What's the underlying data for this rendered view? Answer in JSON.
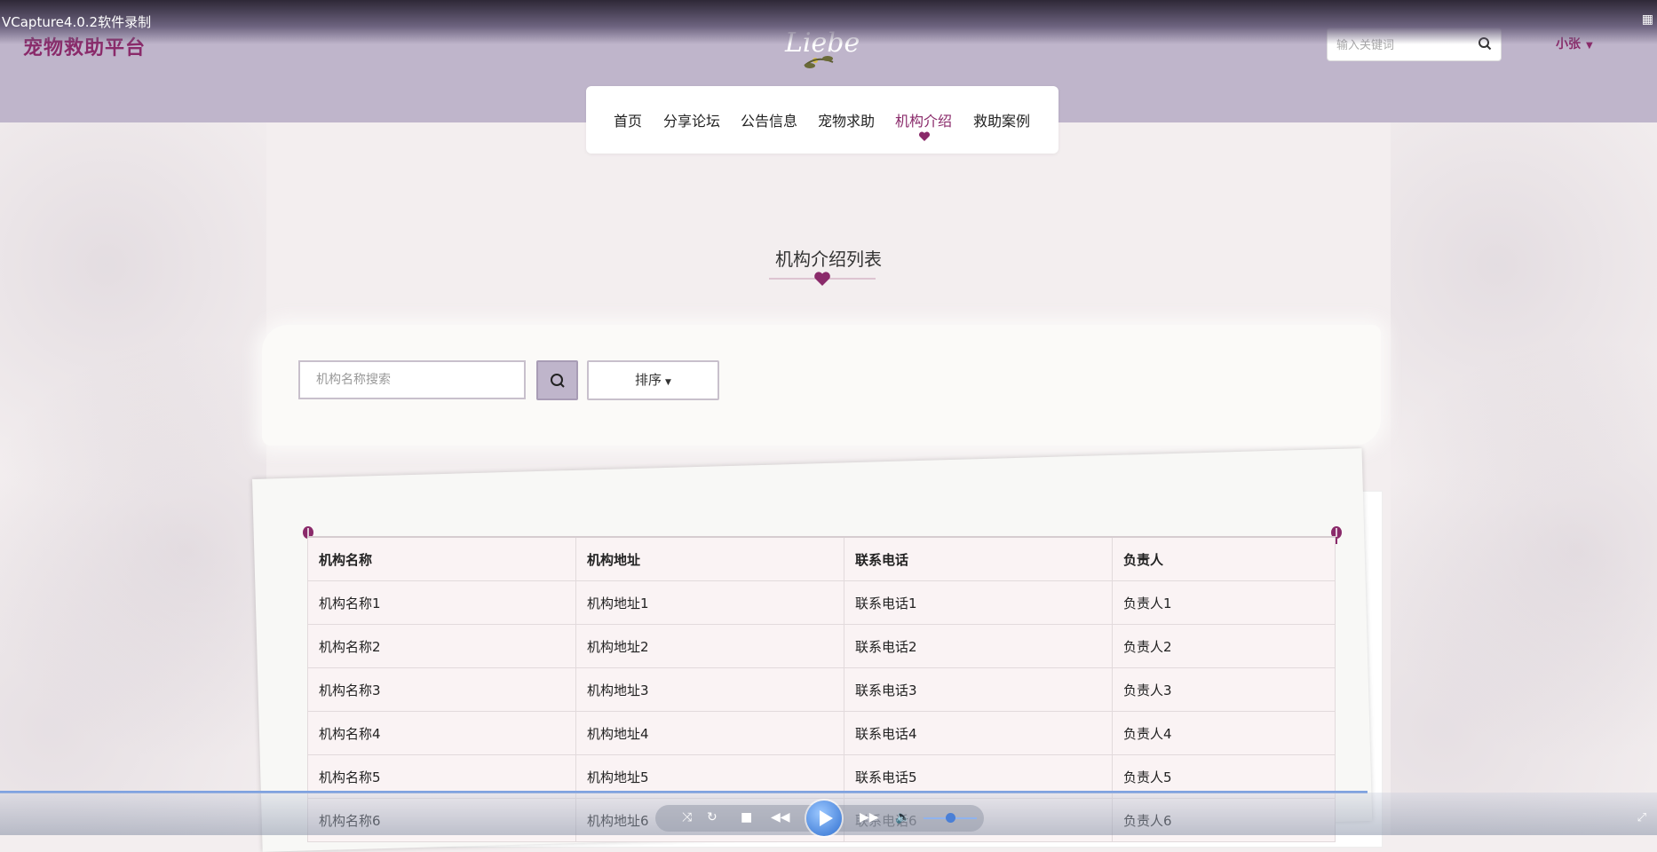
{
  "recorder": {
    "title": "VCapture4.0.2软件录制"
  },
  "header": {
    "brand": "宠物救助平台",
    "logo_text": "Liebe",
    "search_placeholder": "输入关键词",
    "user": "小张"
  },
  "nav": {
    "items": [
      "首页",
      "分享论坛",
      "公告信息",
      "宠物求助",
      "机构介绍",
      "救助案例"
    ],
    "active_index": 4
  },
  "section": {
    "title": "机构介绍列表"
  },
  "filter": {
    "name_placeholder": "机构名称搜索",
    "sort_label": "排序"
  },
  "table": {
    "headers": [
      "机构名称",
      "机构地址",
      "联系电话",
      "负责人"
    ],
    "rows": [
      [
        "机构名称1",
        "机构地址1",
        "联系电话1",
        "负责人1"
      ],
      [
        "机构名称2",
        "机构地址2",
        "联系电话2",
        "负责人2"
      ],
      [
        "机构名称3",
        "机构地址3",
        "联系电话3",
        "负责人3"
      ],
      [
        "机构名称4",
        "机构地址4",
        "联系电话4",
        "负责人4"
      ],
      [
        "机构名称5",
        "机构地址5",
        "联系电话5",
        "负责人5"
      ],
      [
        "机构名称6",
        "机构地址6",
        "联系电话6",
        "负责人6"
      ]
    ]
  },
  "colors": {
    "brand": "#8a2a6a",
    "header_bg": "#bfb5cb",
    "page_bg": "#f3eeef"
  },
  "icons": {
    "search": "search-icon",
    "heart": "heart-icon",
    "pin": "pin-icon",
    "play": "play-icon"
  }
}
